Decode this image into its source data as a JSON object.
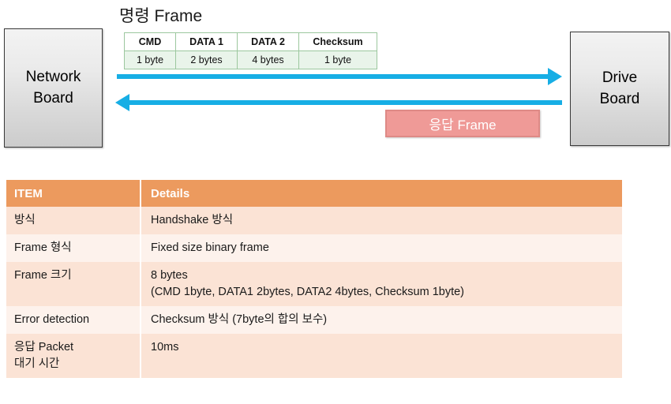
{
  "diagram": {
    "left_board": {
      "name": "Network Board",
      "line1": "Network",
      "line2": "Board"
    },
    "right_board": {
      "name": "Drive Board",
      "line1": "Drive",
      "line2": "Board"
    },
    "command_frame": {
      "title": "명령 Frame",
      "fields": [
        "CMD",
        "DATA 1",
        "DATA 2",
        "Checksum"
      ],
      "sizes": [
        "1 byte",
        "2 bytes",
        "4 bytes",
        "1 byte"
      ]
    },
    "response_badge": {
      "label": "응답 Frame"
    },
    "arrows": {
      "command_direction": "right",
      "response_direction": "left",
      "color": "#17AEE5"
    }
  },
  "detail_table": {
    "headers": [
      "ITEM",
      "Details"
    ],
    "header_bg": "#EC9A5E",
    "row_bg_a": "#FBE3D5",
    "row_bg_b": "#FDF2EC",
    "rows": [
      {
        "item": "방식",
        "details_lines": [
          "Handshake 방식"
        ]
      },
      {
        "item": "Frame 형식",
        "details_lines": [
          "Fixed size binary frame"
        ]
      },
      {
        "item": "Frame 크기",
        "details_lines": [
          "8 bytes",
          "(CMD 1byte, DATA1 2bytes, DATA2 4bytes, Checksum 1byte)"
        ]
      },
      {
        "item": "Error detection",
        "details_lines": [
          "Checksum 방식 (7byte의 합의 보수)"
        ]
      },
      {
        "item_lines": [
          "응답 Packet",
          "대기 시간"
        ],
        "item": "응답 Packet 대기 시간",
        "details_lines": [
          "10ms"
        ]
      }
    ]
  }
}
